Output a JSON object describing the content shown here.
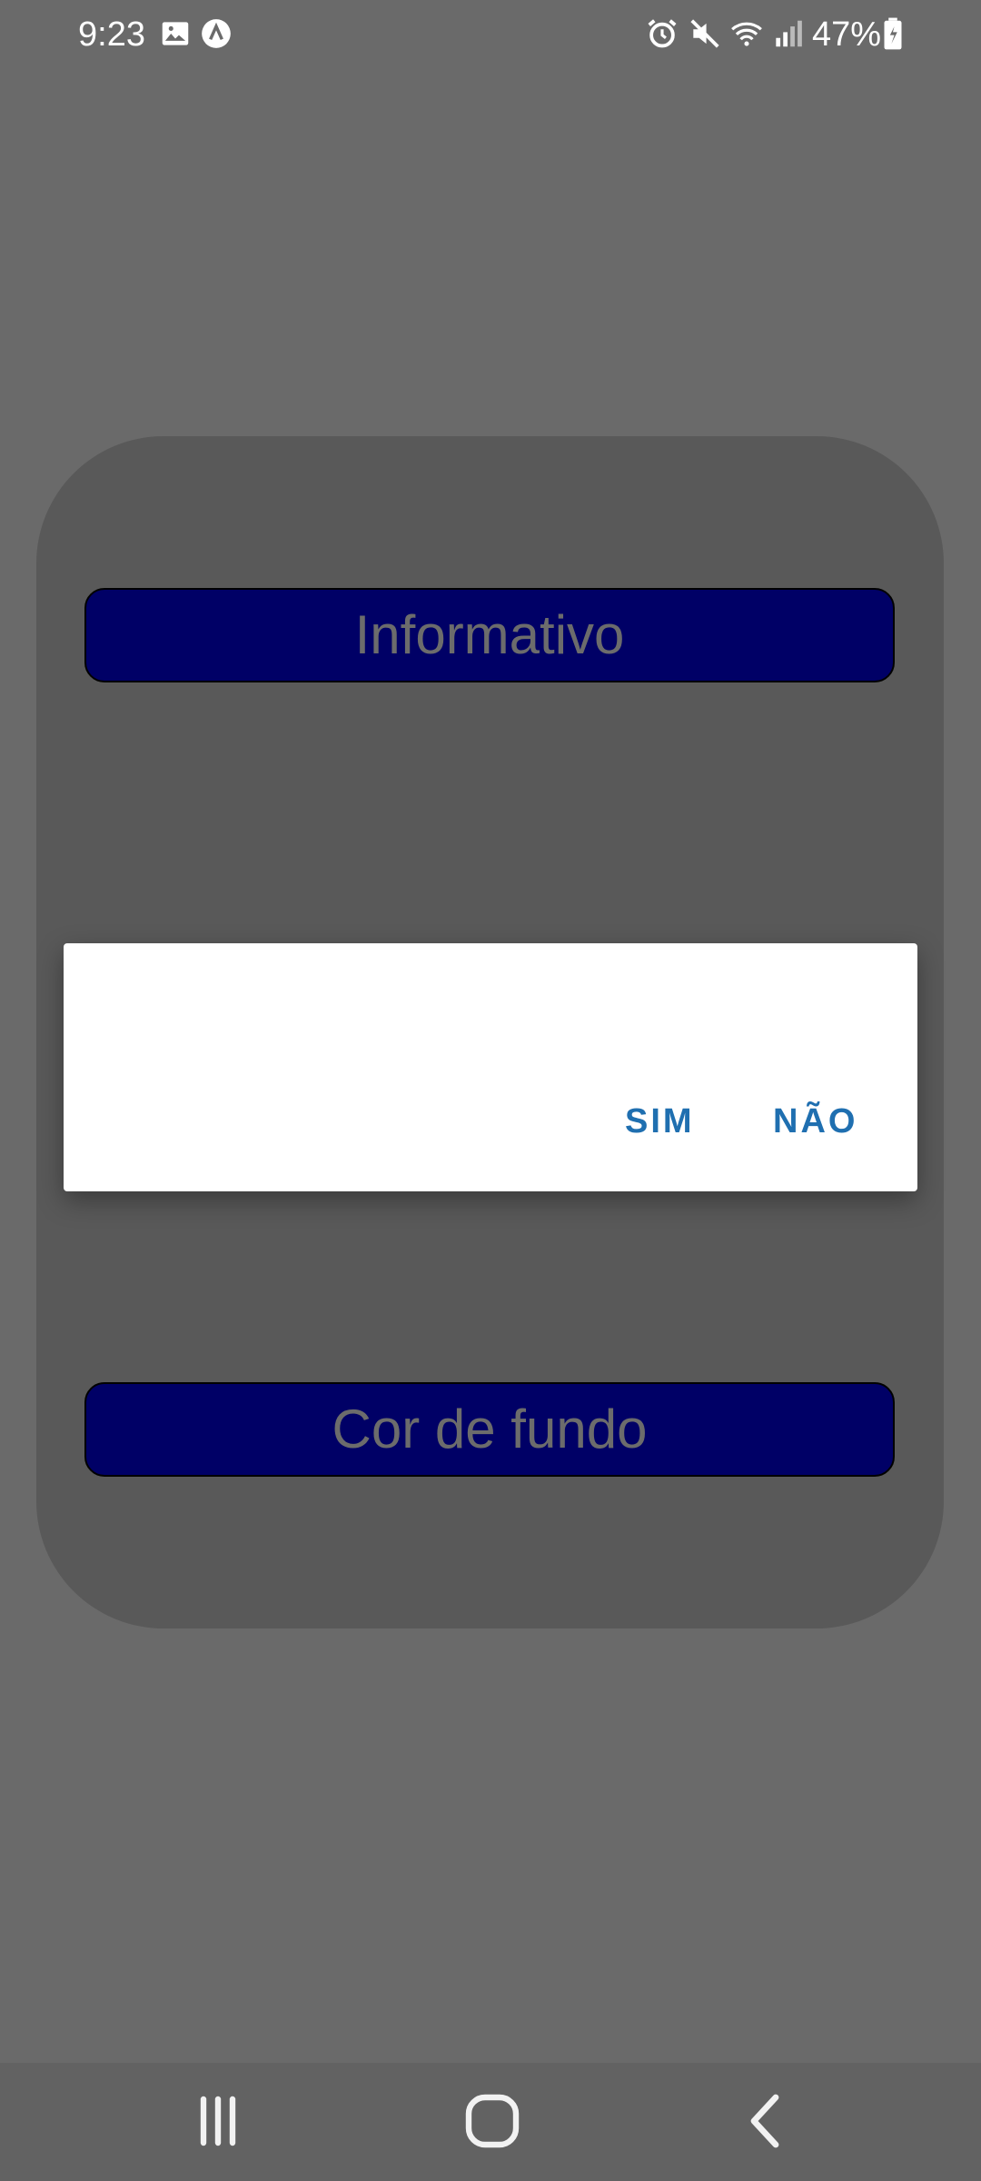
{
  "status_bar": {
    "time": "9:23",
    "battery": "47%",
    "icons": [
      "image-icon",
      "a-logo-icon",
      "alarm-icon",
      "mute-icon",
      "wifi-icon",
      "signal-icon",
      "battery-icon"
    ]
  },
  "main": {
    "informativo_label": "Informativo",
    "cor_de_fundo_label": "Cor de fundo"
  },
  "dialog": {
    "sim_label": "SIM",
    "nao_label": "NÃO"
  },
  "nav": {
    "icons": [
      "recents-icon",
      "home-icon",
      "back-icon"
    ]
  },
  "colors": {
    "background": "#6a6a6a",
    "card": "#595959",
    "button": "#000066",
    "dialog_accent": "#1f6fb0"
  }
}
